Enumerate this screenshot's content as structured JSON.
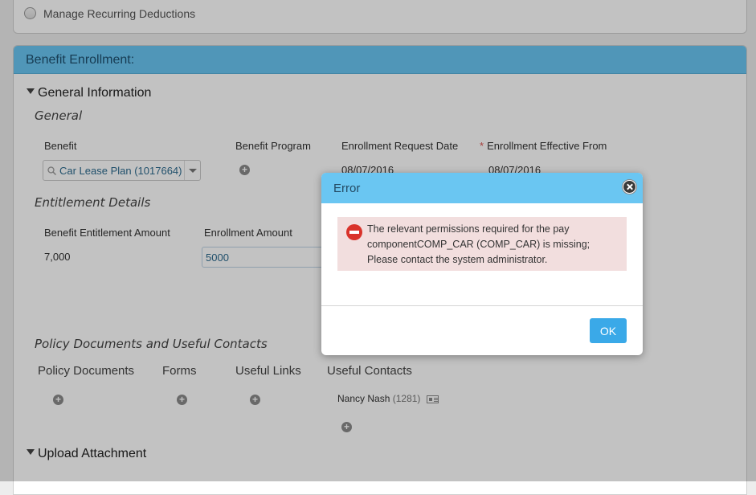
{
  "recurring": {
    "label": "Manage Recurring Deductions"
  },
  "card": {
    "title": "Benefit Enrollment:"
  },
  "general_info": {
    "toggle": "General Information",
    "subhead": "General"
  },
  "fields": {
    "benefit_label": "Benefit",
    "benefit_value": "Car Lease Plan (1017664)",
    "program_label": "Benefit Program",
    "request_date_label": "Enrollment Request Date",
    "request_date_value": "08/07/2016",
    "effective_label": "Enrollment Effective From",
    "effective_required": "*",
    "effective_value": "08/07/2016"
  },
  "entitlement": {
    "subhead": "Entitlement Details",
    "amount_label": "Benefit Entitlement Amount",
    "amount_value": "7,000",
    "enroll_label": "Enrollment Amount",
    "enroll_value": "5000"
  },
  "policy": {
    "subhead": "Policy Documents and Useful Contacts",
    "tabs": [
      "Policy Documents",
      "Forms",
      "Useful Links",
      "Useful Contacts"
    ],
    "contact_name": "Nancy Nash",
    "contact_id": "(1281)"
  },
  "upload": {
    "toggle": "Upload Attachment"
  },
  "dialog": {
    "title": "Error",
    "message": "The relevant permissions required for the pay componentCOMP_CAR (COMP_CAR) is missing; Please contact the system administrator.",
    "ok_label": "OK"
  },
  "colors": {
    "header": "#6ac6f2",
    "error_bg": "#f2dede",
    "ok_button": "#3aa9e8"
  }
}
